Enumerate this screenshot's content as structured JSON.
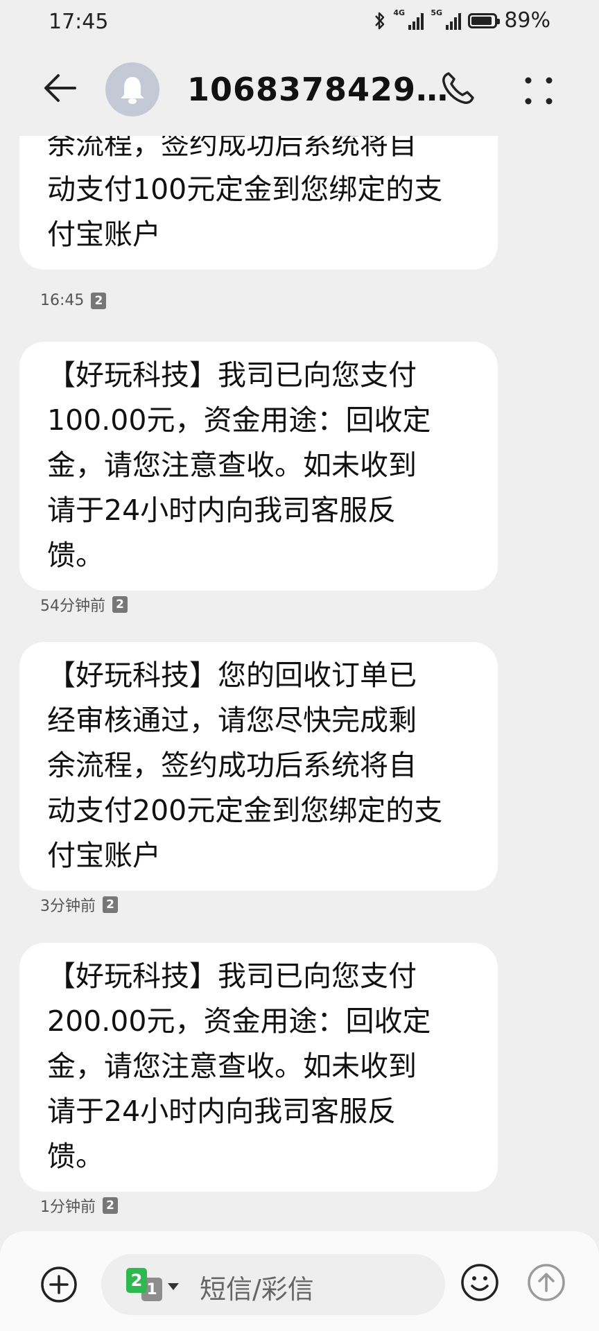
{
  "status_bar": {
    "time": "17:45",
    "battery_percent": "89%",
    "battery_level": 0.89,
    "signal1_network": "4G",
    "signal2_network": "5G",
    "icons": [
      "bluetooth-icon",
      "signal-icon",
      "signal-icon",
      "battery-icon"
    ]
  },
  "header": {
    "contact_number": "1068378429…",
    "avatar_icon": "bell-icon",
    "back_icon": "arrow-left-icon",
    "call_icon": "phone-icon",
    "more_icon": "more-dots-icon"
  },
  "messages": [
    {
      "lines": [
        "余流程，签约成功后系统将自",
        "动支付100元定金到您绑定的支",
        "付宝账户"
      ],
      "time": "16:45",
      "sim": "2"
    },
    {
      "lines": [
        "【好玩科技】我司已向您支付",
        "100.00元，资金用途：回收定",
        "金，请您注意查收。如未收到",
        "请于24小时内向我司客服反",
        "馈。"
      ],
      "time": "54分钟前",
      "sim": "2"
    },
    {
      "lines": [
        "【好玩科技】您的回收订单已",
        "经审核通过，请您尽快完成剩",
        "余流程，签约成功后系统将自",
        "动支付200元定金到您绑定的支",
        "付宝账户"
      ],
      "time": "3分钟前",
      "sim": "2"
    },
    {
      "lines": [
        "【好玩科技】我司已向您支付",
        "200.00元，资金用途：回收定",
        "金，请您注意查收。如未收到",
        "请于24小时内向我司客服反",
        "馈。"
      ],
      "time": "1分钟前",
      "sim": "2"
    }
  ],
  "input_bar": {
    "placeholder": "短信/彩信",
    "sim_primary": "2",
    "sim_secondary": "1",
    "icons": [
      "plus-circle-icon",
      "emoji-icon",
      "send-arrow-icon"
    ]
  },
  "colors": {
    "background": "#efefef",
    "bubble": "#ffffff",
    "avatar": "#c3cad6",
    "sim_active": "#2fb84f"
  }
}
